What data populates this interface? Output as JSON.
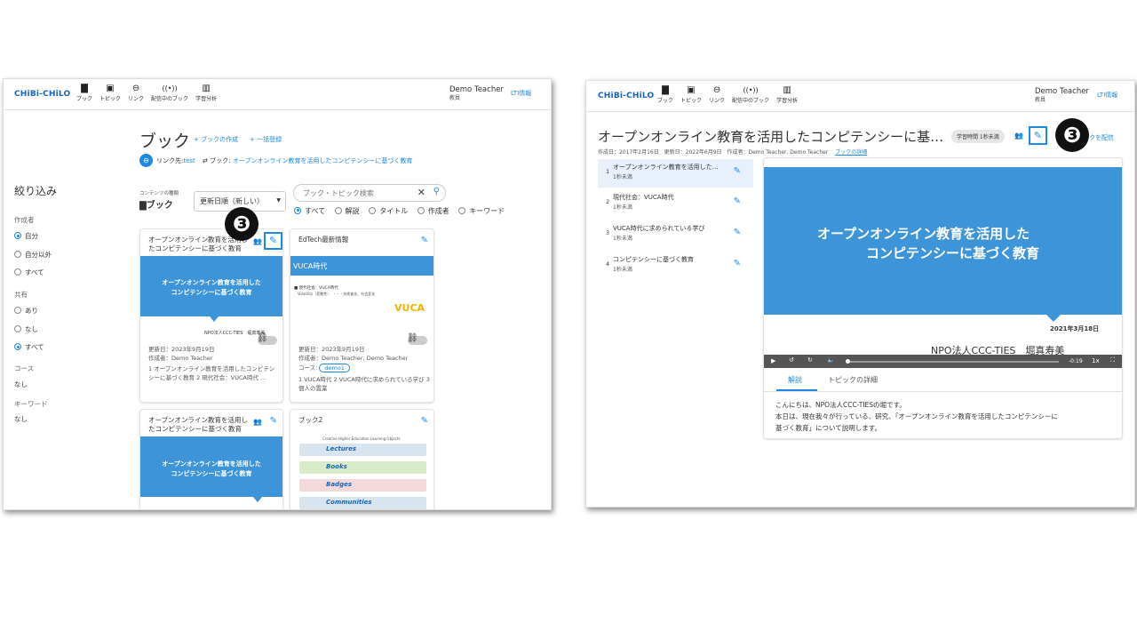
{
  "left": {
    "logo": "CHiBi-CHiLO",
    "nav": [
      {
        "icon": "book-icon",
        "glyph": "📖",
        "label": "ブック"
      },
      {
        "icon": "topic-icon",
        "glyph": "▣",
        "label": "トピック"
      },
      {
        "icon": "link-icon",
        "glyph": "⊖",
        "label": "リンク"
      },
      {
        "icon": "broadcast-icon",
        "glyph": "((•))",
        "label": "配信中のブック"
      },
      {
        "icon": "analytics-icon",
        "glyph": "▥",
        "label": "学習分析"
      }
    ],
    "user_name": "Demo Teacher",
    "user_role": "教員",
    "lti": "LTI情報",
    "title": "ブック",
    "create": "+ ブックの作成",
    "bulk": "+ 一括登録",
    "link_prefix": "リンク先:",
    "link_target": "test",
    "book_prefix": "ブック:",
    "book_target": "オープンオンライン教育を活用したコンピテンシーに基づく教育",
    "filter_title": "絞り込み",
    "author_label": "作成者",
    "author_opts": [
      "自分",
      "自分以外",
      "すべて"
    ],
    "share_label": "共有",
    "share_opts": [
      "あり",
      "なし",
      "すべて"
    ],
    "course_label": "コース",
    "course_val": "なし",
    "keyword_label": "キーワード",
    "keyword_val": "なし",
    "content_type_label": "コンテンツの種類",
    "content_type": "ブック",
    "sort": "更新日順（新しい）",
    "search_placeholder": "ブック・トピック検索",
    "search_opts": [
      "すべて",
      "解説",
      "タイトル",
      "作成者",
      "キーワード"
    ],
    "cards": [
      {
        "title": "オープンオンライン教育を活用したコンピテンシーに基づく教育",
        "thumb": "オープンオンライン教育を活用した\nコンピテンシーに基づく教育",
        "foot": "NPO法人CCC-TIES　堀真寿美",
        "updated": "更新日：2023年9月19日",
        "author": "作成者：Demo Teacher",
        "topics": "1 オープンオンライン教育を活用したコンピテンシーに基づく教育 2 現代社会：VUCA時代 …"
      },
      {
        "title": "EdTech最新情報",
        "thumb": "VUCA時代",
        "sub1": "■ 現代社会：VUCA時代",
        "sub2": "Volatility（変動性）　・・・技術進化、社会変化",
        "badge": "VUCA",
        "updated": "更新日：2023年9月19日",
        "author": "作成者：Demo Teacher, Demo Teacher",
        "course_label": "コース:",
        "course": "demo1",
        "topics": "1 VUCA時代 2 VUCA時代に求められている学び 3 個人の置業"
      },
      {
        "title": "オープンオンライン教育を活用したコンピテンシーに基づく教育",
        "thumb": "オープンオンライン教育を活用した\nコンピテンシーに基づく教育"
      },
      {
        "title": "ブック2",
        "thumb_title": "Creative Higher Education Learning Objects",
        "rows": [
          "Lectures",
          "Books",
          "Badges",
          "Communities"
        ]
      }
    ],
    "callout": "❸"
  },
  "right": {
    "logo": "CHiBi-CHiLO",
    "nav": [
      {
        "icon": "book-icon",
        "glyph": "📖",
        "label": "ブック"
      },
      {
        "icon": "topic-icon",
        "glyph": "▣",
        "label": "トピック"
      },
      {
        "icon": "link-icon",
        "glyph": "⊖",
        "label": "リンク"
      },
      {
        "icon": "broadcast-icon",
        "glyph": "((•))",
        "label": "配信中のブック"
      },
      {
        "icon": "analytics-icon",
        "glyph": "▥",
        "label": "学習分析"
      }
    ],
    "user_name": "Demo Teacher",
    "user_role": "教員",
    "lti": "LTI情報",
    "title": "オープンオンライン教育を活用したコンピテンシーに基…",
    "time_chip": "学習時間 1秒未満",
    "deliver": "クを配信",
    "meta_created": "作成日：2017年2月16日",
    "meta_updated": "更新日：2022年6月9日",
    "meta_author": "作成者：Demo Teacher, Demo Teacher",
    "detail_link": "ブックの詳細",
    "topics": [
      {
        "n": "1",
        "title": "オープンオンライン教育を活用した…",
        "time": "1秒未満"
      },
      {
        "n": "2",
        "title": "現代社会：VUCA時代",
        "time": "1秒未満"
      },
      {
        "n": "3",
        "title": "VUCA時代に求められている学び",
        "time": "1秒未満"
      },
      {
        "n": "4",
        "title": "コンピテンシーに基づく教育",
        "time": "1秒未満"
      }
    ],
    "slide_line1": "オープンオンライン教育を活用した",
    "slide_line2": "コンピテンシーに基づく教育",
    "slide_date": "2021年3月18日",
    "slide_org": "NPO法人CCC-TIES　堀真寿美",
    "video_time": "-0:19",
    "video_speed": "1x",
    "tab_explain": "解説",
    "tab_detail": "トピックの詳細",
    "desc1": "こんにちは、NPO法人CCC-TIESの堀です。",
    "desc2": "本日は、現在我々が行っている、研究、「オープンオンライン教育を活用したコンピテンシーに",
    "desc3": "基づく教育」について説明します。",
    "callout": "❸"
  }
}
